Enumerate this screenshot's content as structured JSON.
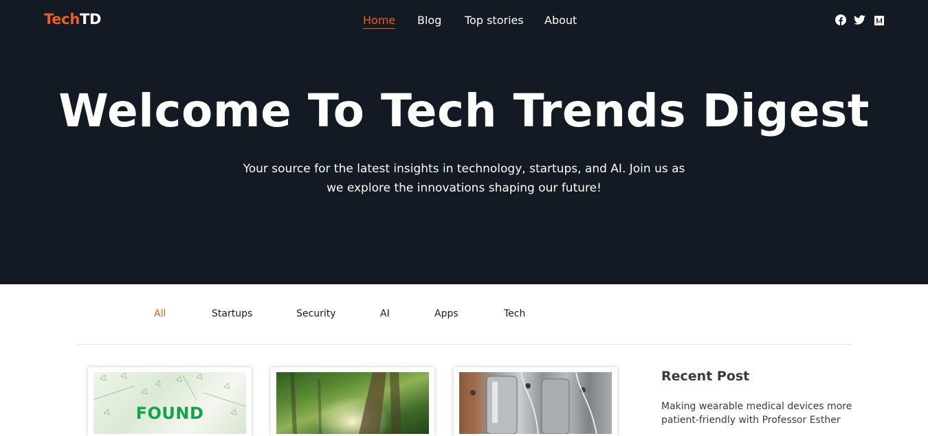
{
  "brand": {
    "part1": "Tech",
    "part2": "TD"
  },
  "nav": {
    "items": [
      {
        "label": "Home",
        "active": true
      },
      {
        "label": "Blog",
        "active": false
      },
      {
        "label": "Top stories",
        "active": false
      },
      {
        "label": "About",
        "active": false
      }
    ]
  },
  "social": {
    "icons": [
      "facebook-icon",
      "twitter-icon",
      "medium-icon"
    ]
  },
  "hero": {
    "title": "Welcome To Tech Trends Digest",
    "subtitle": "Your source for the latest insights in technology, startups, and AI. Join us as we explore the innovations shaping our future!"
  },
  "filters": {
    "items": [
      "All",
      "Startups",
      "Security",
      "AI",
      "Apps",
      "Tech"
    ],
    "selected": "All"
  },
  "cards": [
    {
      "image_text": "FOUND"
    },
    {
      "image_text": ""
    },
    {
      "image_text": ""
    }
  ],
  "sidebar": {
    "title": "Recent Post",
    "recent_post": "Making wearable medical devices more patient-friendly with Professor Esther"
  },
  "colors": {
    "accent": "#e8601c",
    "hero_bg": "#131a24",
    "found_green": "#14a24a"
  }
}
